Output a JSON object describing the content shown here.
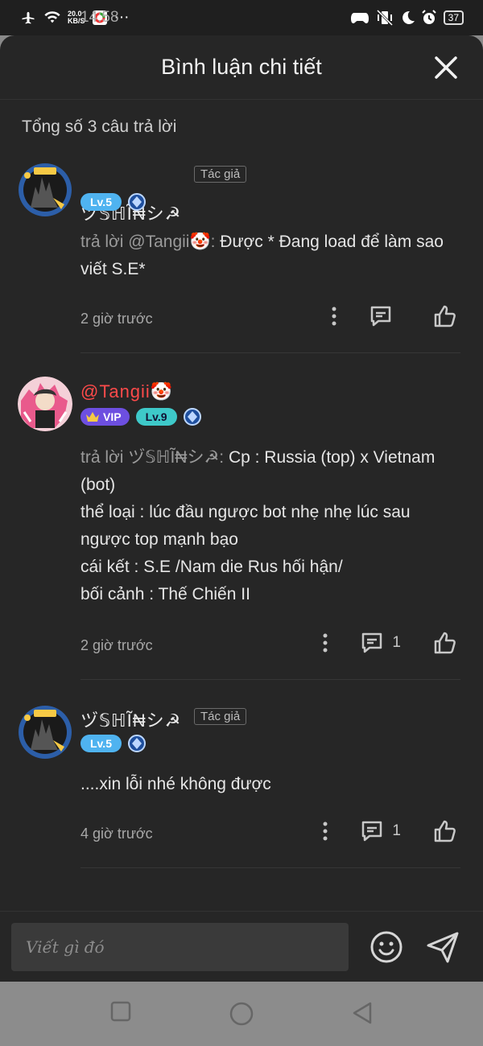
{
  "status_bar": {
    "time": "14:58",
    "net_speed_value": "20.0",
    "net_speed_unit": "KB/S",
    "more": "···",
    "battery": "37"
  },
  "header": {
    "title": "Bình luận chi tiết"
  },
  "summary": {
    "count_text": "Tổng số 3 câu trả lời"
  },
  "comments": [
    {
      "username": "ヅ𝕊ℍĨ₦シ☭",
      "author_tag": "Tác giả",
      "level": "Lv.5",
      "reply_prefix": "trả lời @Tangii🤡:",
      "text": " Được * Đang load để làm sao viết S.E*",
      "time": "2 giờ trước",
      "reply_count": ""
    },
    {
      "username": "@Tangii🤡",
      "vip": "VIP",
      "level": "Lv.9",
      "reply_prefix": "trả lời ヅ𝕊ℍĨ₦シ☭:",
      "lines": [
        " Cp : Russia (top) x Vietnam (bot)",
        "thể loại : lúc đầu ngược bot nhẹ nhẹ lúc sau ngược top mạnh bạo",
        "cái kết : S.E /Nam die Rus hối hận/",
        "bối cảnh : Thế Chiến II"
      ],
      "time": "2 giờ trước",
      "reply_count": "1"
    },
    {
      "username": "ヅ𝕊ℍĨ₦シ☭",
      "author_tag": "Tác giả",
      "level": "Lv.5",
      "text": "....xin lỗi nhé không được",
      "time": "4 giờ trước",
      "reply_count": "1"
    }
  ],
  "input": {
    "placeholder": "Viết gì đó"
  },
  "colors": {
    "sheet_bg": "#262626",
    "username_highlight": "#ff4a4a",
    "level_blue": "#4fb3f0",
    "level_teal": "#3ec9c9",
    "vip_purple": "#6d4fe0"
  }
}
